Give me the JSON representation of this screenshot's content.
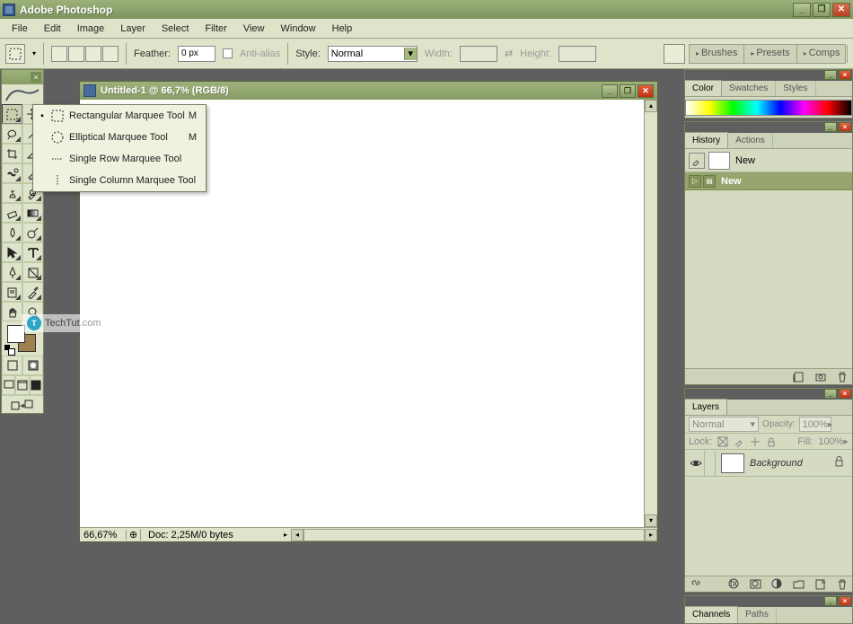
{
  "app_title": "Adobe Photoshop",
  "menu": [
    "File",
    "Edit",
    "Image",
    "Layer",
    "Select",
    "Filter",
    "View",
    "Window",
    "Help"
  ],
  "optbar": {
    "feather_label": "Feather:",
    "feather_value": "0 px",
    "antialias": "Anti-alias",
    "style_label": "Style:",
    "style_value": "Normal",
    "width_label": "Width:",
    "height_label": "Height:"
  },
  "well": [
    "Brushes",
    "Presets",
    "Comps"
  ],
  "flyout": [
    {
      "label": "Rectangular Marquee Tool",
      "key": "M",
      "active": true
    },
    {
      "label": "Elliptical Marquee Tool",
      "key": "M",
      "active": false
    },
    {
      "label": "Single Row Marquee Tool",
      "key": "",
      "active": false
    },
    {
      "label": "Single Column Marquee Tool",
      "key": "",
      "active": false
    }
  ],
  "doc": {
    "title": "Untitled-1 @ 66,7% (RGB/8)",
    "zoom": "66,67%",
    "info": "Doc: 2,25M/0 bytes"
  },
  "watermark": {
    "brand": "TechTut",
    "suffix": ".com"
  },
  "color_panel": {
    "tabs": [
      "Color",
      "Swatches",
      "Styles"
    ]
  },
  "history_panel": {
    "tabs": [
      "History",
      "Actions"
    ],
    "snapshot": "New",
    "state": "New"
  },
  "layers_panel": {
    "tabs": [
      "Layers"
    ],
    "blend": "Normal",
    "opacity_label": "Opacity:",
    "opacity": "100%",
    "lock_label": "Lock:",
    "fill_label": "Fill:",
    "fill": "100%",
    "layer_name": "Background"
  },
  "channels_panel": {
    "tabs": [
      "Channels",
      "Paths"
    ]
  }
}
